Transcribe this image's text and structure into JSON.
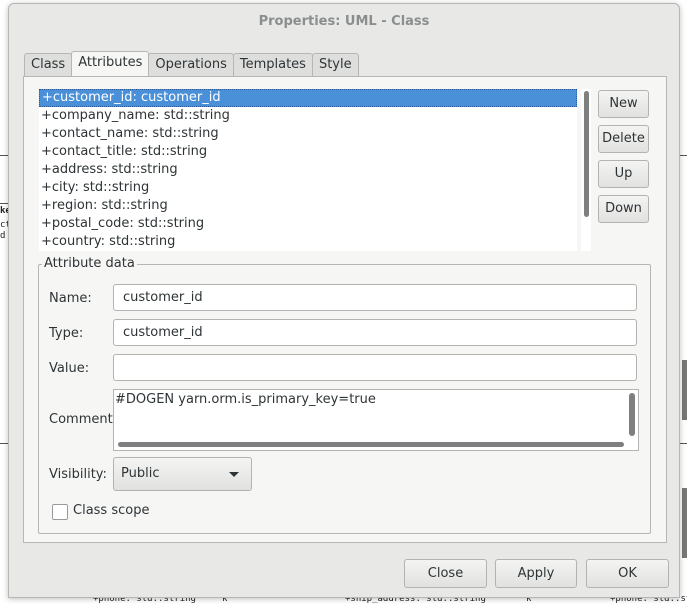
{
  "window": {
    "title": "Properties: UML - Class"
  },
  "tabs": [
    {
      "label": "Class"
    },
    {
      "label": "Attributes"
    },
    {
      "label": "Operations"
    },
    {
      "label": "Templates"
    },
    {
      "label": "Style"
    }
  ],
  "active_tab": "Attributes",
  "attributes": [
    "+customer_id: customer_id",
    "+company_name: std::string",
    "+contact_name: std::string",
    "+contact_title: std::string",
    "+address: std::string",
    "+city: std::string",
    "+region: std::string",
    "+postal_code: std::string",
    "+country: std::string"
  ],
  "selected_attribute": "+customer_id: customer_id",
  "list_buttons": {
    "new": "New",
    "delete": "Delete",
    "up": "Up",
    "down": "Down"
  },
  "attribute_data": {
    "frame_title": "Attribute data",
    "name_label": "Name:",
    "name_value": "customer_id",
    "type_label": "Type:",
    "type_value": "customer_id",
    "value_label": "Value:",
    "value_value": "",
    "comment_label": "Comment:",
    "comment_value": "#DOGEN yarn.orm.is_primary_key=true",
    "visibility_label": "Visibility:",
    "visibility_value": "Public",
    "class_scope_label": "Class scope",
    "class_scope_checked": false
  },
  "dialog_buttons": {
    "close": "Close",
    "apply": "Apply",
    "ok": "OK"
  },
  "background": {
    "left_fragments": [
      "ke",
      "ct",
      "d"
    ],
    "bottom_fragments": [
      "+phone: std::string",
      "k",
      "+ship_address: std::string",
      "k",
      "+phone: std::string"
    ]
  }
}
